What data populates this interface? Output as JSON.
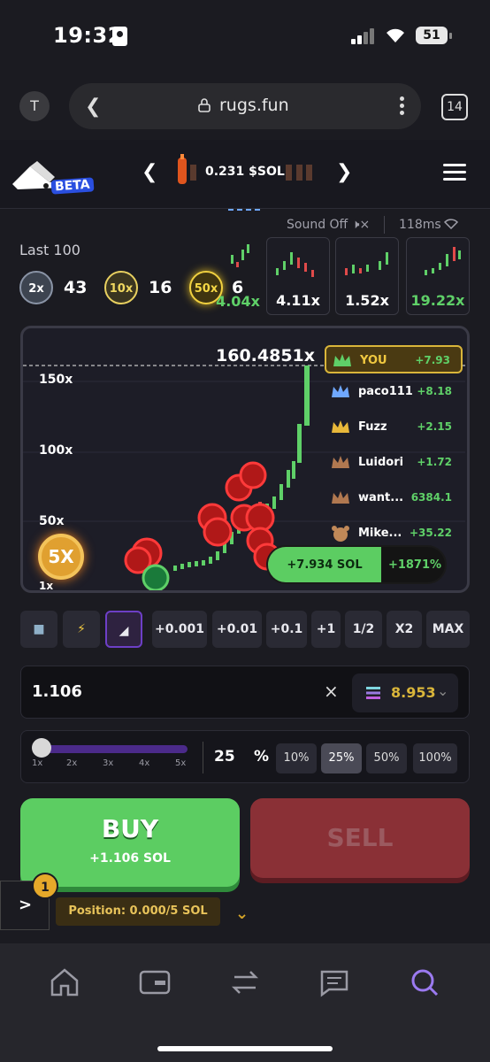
{
  "status": {
    "time": "19:32",
    "battery": "51"
  },
  "browser": {
    "avatar": "T",
    "url": "rugs.fun",
    "tabs_count": "14"
  },
  "header": {
    "beta_label": "BETA",
    "price_label": "0.231 $SOL"
  },
  "sound": {
    "label": "Sound Off",
    "latency": "118ms"
  },
  "history": {
    "title": "Last 100",
    "badges": [
      {
        "label": "2x",
        "count": "43"
      },
      {
        "label": "10x",
        "count": "16"
      },
      {
        "label": "50x",
        "count": "6"
      }
    ],
    "recent": [
      {
        "label": "4.04x",
        "color": "#5fd068"
      },
      {
        "label": "4.11x",
        "color": "#ffffff"
      },
      {
        "label": "1.52x",
        "color": "#ffffff"
      },
      {
        "label": "19.22x",
        "color": "#5fd068"
      }
    ]
  },
  "chart": {
    "peak": "160.4851x",
    "y_labels": [
      "150x",
      "100x",
      "50x",
      "1x"
    ],
    "multiplier_badge": "5X",
    "pnl_sol": "+7.934 SOL",
    "pnl_pct": "+1871%",
    "leaderboard": [
      {
        "name": "YOU",
        "pnl": "+7.93",
        "crown": "#5fd068",
        "highlight": true
      },
      {
        "name": "paco111",
        "pnl": "+8.18",
        "crown": "#6fa8ff"
      },
      {
        "name": "Fuzz",
        "pnl": "+2.15",
        "crown": "#e8b83a"
      },
      {
        "name": "Luidori",
        "pnl": "+1.72",
        "crown": "#b07850"
      },
      {
        "name": "want...",
        "pnl": "6384.1",
        "crown": "#b07850"
      },
      {
        "name": "Mike...",
        "pnl": "+35.22",
        "crown": "#c08858"
      }
    ]
  },
  "controls": {
    "quick": [
      "+0.001",
      "+0.01",
      "+0.1",
      "+1",
      "1/2",
      "X2",
      "MAX"
    ],
    "amount": "1.106",
    "clear": "×",
    "balance": "8.953",
    "slider_ticks": [
      "1x",
      "2x",
      "3x",
      "4x",
      "5x"
    ],
    "percent_value": "25",
    "percent_sign": "%",
    "percent_options": [
      "10%",
      "25%",
      "50%",
      "100%"
    ],
    "buy_label": "BUY",
    "buy_sub": "+1.106 SOL",
    "sell_label": "SELL",
    "side_toggle": ">",
    "notification_count": "1",
    "position": "Position: 0.000/5 SOL"
  },
  "colors": {
    "accent_green": "#5ccd62",
    "sell_red": "#8a3036",
    "gold": "#d9b53a",
    "purple": "#6d3fc6"
  }
}
